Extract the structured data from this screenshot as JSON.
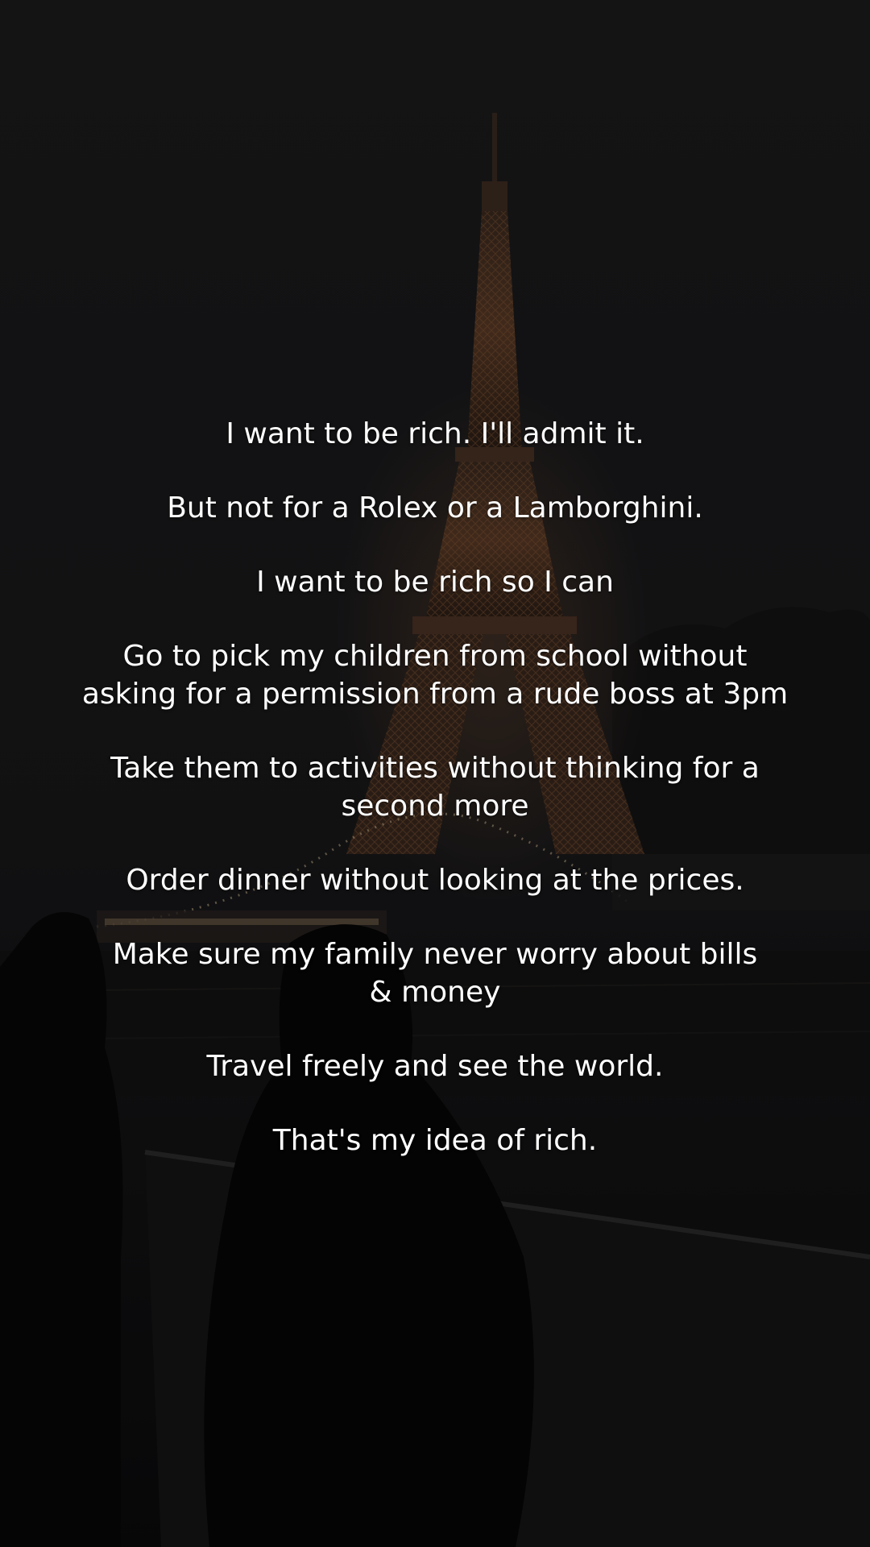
{
  "colors": {
    "sky": "#1b1b1d",
    "tower_lights": "#a8643a",
    "text": "#ffffff"
  },
  "story": {
    "lines": [
      "I want to be rich. I'll admit it.",
      "But not for a Rolex or a Lamborghini.",
      "I want to be rich so I can",
      "Go to pick my children from school without asking for a permission from a rude boss at 3pm",
      "Take them to activities without thinking for a second more",
      "Order dinner without looking at the prices.",
      "Make sure my family never worry about bills & money",
      "Travel freely and see the world.",
      "That's my idea of rich."
    ]
  }
}
